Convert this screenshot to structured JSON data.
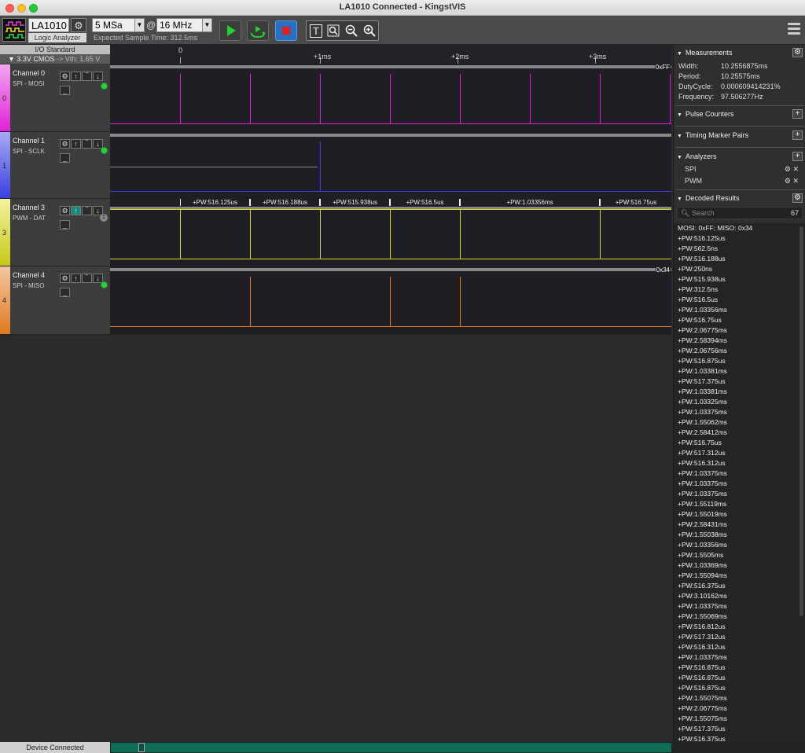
{
  "window": {
    "title": "LA1010 Connected - KingstVIS"
  },
  "toolbar": {
    "device_name": "LA1010",
    "device_subtitle": "Logic Analyzer",
    "sample_count": "5 MSa",
    "at_symbol": "@",
    "sample_rate": "16 MHz",
    "expected_time": "Expected Sample Time: 312.5ms",
    "zoom_text_icon": "T",
    "icons": [
      "play-icon",
      "loop-icon",
      "stop-icon",
      "text-icon",
      "zoom-fit-icon",
      "zoom-out-icon",
      "zoom-in-icon",
      "menu-icon"
    ]
  },
  "io": {
    "header": "I/O Standard",
    "standard": "3.3V CMOS",
    "vth": "-> Vth: 1.65 V"
  },
  "channels": [
    {
      "num": "0",
      "name": "Channel 0",
      "analyzer": "SPI - MOSI",
      "color": "#e020d8"
    },
    {
      "num": "1",
      "name": "Channel 1",
      "analyzer": "SPI - SCLK",
      "color": "#3a40e0"
    },
    {
      "num": "3",
      "name": "Channel 3",
      "analyzer": "PWM - DAT",
      "color": "#d8d820",
      "badge": "1"
    },
    {
      "num": "4",
      "name": "Channel 4",
      "analyzer": "SPI - MISO",
      "color": "#e07a20"
    }
  ],
  "ruler": {
    "ticks": [
      "0",
      "+1ms",
      "+2ms",
      "+3ms"
    ]
  },
  "lanes": {
    "ch0_tag": "0xFF",
    "ch4_tag": "0x34",
    "pw_labels": [
      "+PW:516.125us",
      "+PW:516.188us",
      "+PW:515.938us",
      "+PW:516.5us",
      "+PW:1.03356ms",
      "+PW:516.75us"
    ]
  },
  "panel": {
    "measurements": {
      "title": "Measurements",
      "rows": [
        {
          "label": "Width:",
          "value": "10.2556875ms"
        },
        {
          "label": "Period:",
          "value": "10.25575ms"
        },
        {
          "label": "DutyCycle:",
          "value": "0.000609414231%"
        },
        {
          "label": "Frequency:",
          "value": "97.506277Hz"
        }
      ]
    },
    "pulse_counters": "Pulse Counters",
    "timing_marker_pairs": "Timing Marker Pairs",
    "analyzers": {
      "title": "Analyzers",
      "items": [
        "SPI",
        "PWM"
      ]
    },
    "decoded": {
      "title": "Decoded Results",
      "search_placeholder": "Search",
      "count": "67",
      "results": [
        "MOSI: 0xFF;  MISO: 0x34",
        "+PW:516.125us",
        "+PW:562.5ns",
        "+PW:516.188us",
        "+PW:250ns",
        "+PW:515.938us",
        "+PW:312.5ns",
        "+PW:516.5us",
        "+PW:1.03356ms",
        "+PW:516.75us",
        "+PW:2.06775ms",
        "+PW:2.58394ms",
        "+PW:2.06756ms",
        "+PW:516.875us",
        "+PW:1.03381ms",
        "+PW:517.375us",
        "+PW:1.03381ms",
        "+PW:1.03325ms",
        "+PW:1.03375ms",
        "+PW:1.55062ms",
        "+PW:2.58412ms",
        "+PW:516.75us",
        "+PW:517.312us",
        "+PW:516.312us",
        "+PW:1.03375ms",
        "+PW:1.03375ms",
        "+PW:1.03375ms",
        "+PW:1.55119ms",
        "+PW:1.55019ms",
        "+PW:2.58431ms",
        "+PW:1.55038ms",
        "+PW:1.03356ms",
        "+PW:1.5505ms",
        "+PW:1.03369ms",
        "+PW:1.55094ms",
        "+PW:516.375us",
        "+PW:3.10162ms",
        "+PW:1.03375ms",
        "+PW:1.55069ms",
        "+PW:516.812us",
        "+PW:517.312us",
        "+PW:516.312us",
        "+PW:1.03375ms",
        "+PW:516.875us",
        "+PW:516.875us",
        "+PW:516.875us",
        "+PW:1.55075ms",
        "+PW:2.06775ms",
        "+PW:1.55075ms",
        "+PW:517.375us",
        "+PW:516.375us"
      ]
    }
  },
  "status": {
    "connection": "Device Connected"
  }
}
